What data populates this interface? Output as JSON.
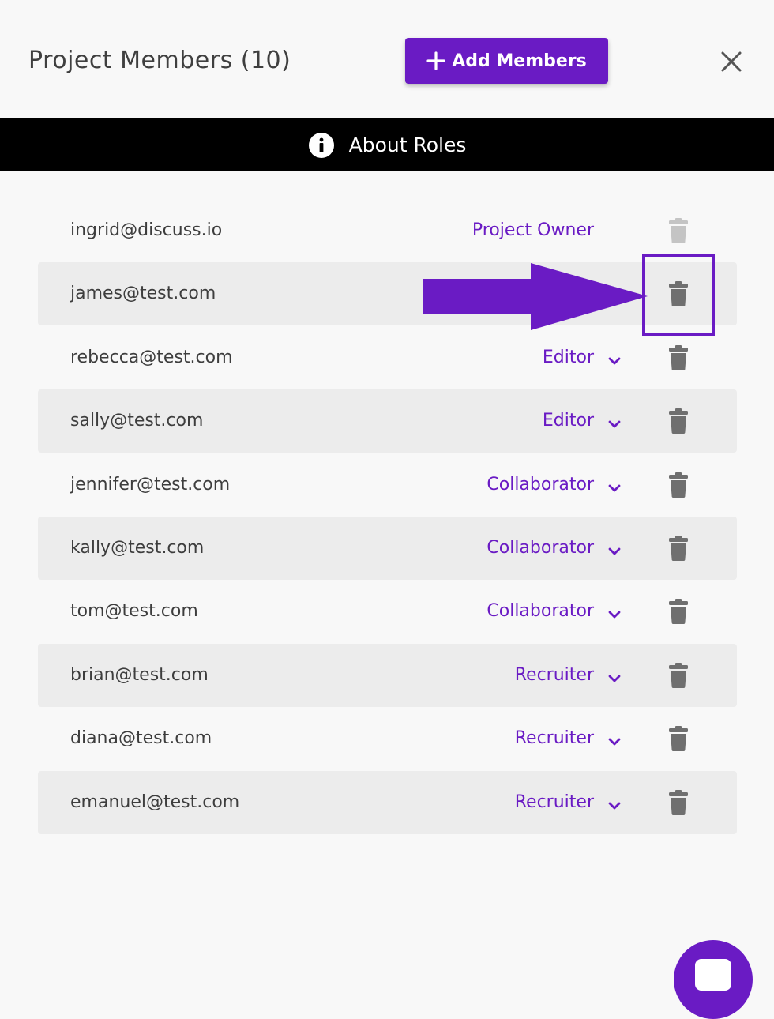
{
  "header": {
    "title": "Project Members (10)",
    "add_members_label": "Add Members",
    "close_icon": "close-icon"
  },
  "roles_bar": {
    "label": "About Roles",
    "icon": "info-icon"
  },
  "colors": {
    "accent": "#6a1bc4",
    "text": "#3d3d3d",
    "row_alt": "#ececec",
    "trash": "#6f6f6f",
    "trash_disabled": "#c4c4c4"
  },
  "members": [
    {
      "email": "ingrid@discuss.io",
      "role": "Project Owner",
      "has_dropdown": false,
      "delete_disabled": true
    },
    {
      "email": "james@test.com",
      "role": "",
      "has_dropdown": false,
      "delete_disabled": false
    },
    {
      "email": "rebecca@test.com",
      "role": "Editor",
      "has_dropdown": true,
      "delete_disabled": false
    },
    {
      "email": "sally@test.com",
      "role": "Editor",
      "has_dropdown": true,
      "delete_disabled": false
    },
    {
      "email": "jennifer@test.com",
      "role": "Collaborator",
      "has_dropdown": true,
      "delete_disabled": false
    },
    {
      "email": "kally@test.com",
      "role": "Collaborator",
      "has_dropdown": true,
      "delete_disabled": false
    },
    {
      "email": "tom@test.com",
      "role": "Collaborator",
      "has_dropdown": true,
      "delete_disabled": false
    },
    {
      "email": "brian@test.com",
      "role": "Recruiter",
      "has_dropdown": true,
      "delete_disabled": false
    },
    {
      "email": "diana@test.com",
      "role": "Recruiter",
      "has_dropdown": true,
      "delete_disabled": false
    },
    {
      "email": "emanuel@test.com",
      "role": "Recruiter",
      "has_dropdown": true,
      "delete_disabled": false
    }
  ]
}
